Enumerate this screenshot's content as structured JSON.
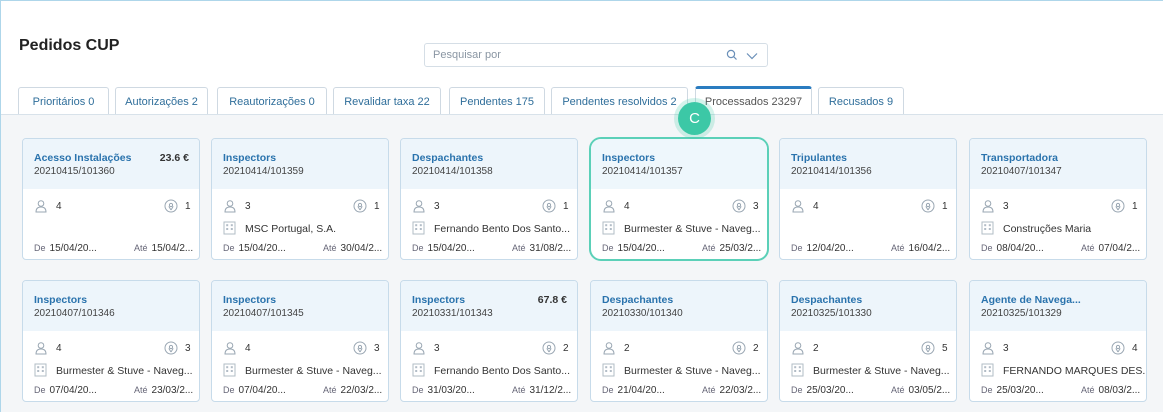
{
  "page": {
    "title": "Pedidos CUP"
  },
  "search": {
    "placeholder": "Pesquisar por"
  },
  "tabs": [
    {
      "label": "Prioritários 0"
    },
    {
      "label": "Autorizações 2"
    },
    {
      "label": "Reautorizações 0"
    },
    {
      "label": "Revalidar taxa 22"
    },
    {
      "label": "Pendentes 175"
    },
    {
      "label": "Pendentes resolvidos 2"
    },
    {
      "label": "Processados 23297",
      "active": true
    },
    {
      "label": "Recusados 9"
    }
  ],
  "badge": {
    "label": "C"
  },
  "date_labels": {
    "from": "De",
    "to": "Até"
  },
  "cards": [
    {
      "title": "Acesso Instalações",
      "amount": "23.6 €",
      "id": "20210415/101360",
      "people": "4",
      "locations": "1",
      "company": "",
      "from": "15/04/20...",
      "to": "15/04/2..."
    },
    {
      "title": "Inspectors",
      "amount": "",
      "id": "20210414/101359",
      "people": "3",
      "locations": "1",
      "company": "MSC Portugal, S.A.",
      "from": "15/04/20...",
      "to": "30/04/2..."
    },
    {
      "title": "Despachantes",
      "amount": "",
      "id": "20210414/101358",
      "people": "3",
      "locations": "1",
      "company": "Fernando Bento Dos Santo...",
      "from": "15/04/20...",
      "to": "31/08/2..."
    },
    {
      "title": "Inspectors",
      "amount": "",
      "id": "20210414/101357",
      "people": "4",
      "locations": "3",
      "company": "Burmester & Stuve - Naveg...",
      "from": "15/04/20...",
      "to": "25/03/2...",
      "selected": true
    },
    {
      "title": "Tripulantes",
      "amount": "",
      "id": "20210414/101356",
      "people": "4",
      "locations": "1",
      "company": "",
      "from": "12/04/20...",
      "to": "16/04/2..."
    },
    {
      "title": "Transportadora",
      "amount": "",
      "id": "20210407/101347",
      "people": "3",
      "locations": "1",
      "company": "Construções Maria",
      "from": "08/04/20...",
      "to": "07/04/2..."
    },
    {
      "title": "Inspectors",
      "amount": "",
      "id": "20210407/101346",
      "people": "4",
      "locations": "3",
      "company": "Burmester & Stuve - Naveg...",
      "from": "07/04/20...",
      "to": "23/03/2..."
    },
    {
      "title": "Inspectors",
      "amount": "",
      "id": "20210407/101345",
      "people": "4",
      "locations": "3",
      "company": "Burmester & Stuve - Naveg...",
      "from": "07/04/20...",
      "to": "22/03/2..."
    },
    {
      "title": "Inspectors",
      "amount": "67.8 €",
      "id": "20210331/101343",
      "people": "3",
      "locations": "2",
      "company": "Fernando Bento Dos Santo...",
      "from": "31/03/20...",
      "to": "31/12/2..."
    },
    {
      "title": "Despachantes",
      "amount": "",
      "id": "20210330/101340",
      "people": "2",
      "locations": "2",
      "company": "Burmester & Stuve - Naveg...",
      "from": "21/04/20...",
      "to": "22/03/2..."
    },
    {
      "title": "Despachantes",
      "amount": "",
      "id": "20210325/101330",
      "people": "2",
      "locations": "5",
      "company": "Burmester & Stuve - Naveg...",
      "from": "25/03/20...",
      "to": "03/05/2..."
    },
    {
      "title": "Agente de Navega...",
      "amount": "",
      "id": "20210325/101329",
      "people": "3",
      "locations": "4",
      "company": "FERNANDO MARQUES DES...",
      "from": "25/03/20...",
      "to": "08/03/2..."
    }
  ]
}
